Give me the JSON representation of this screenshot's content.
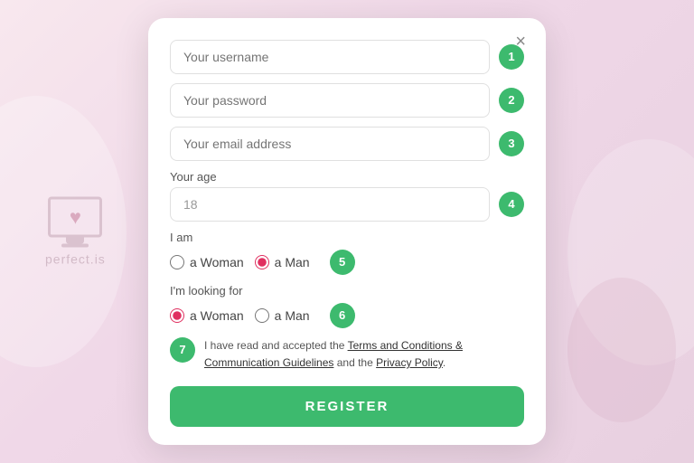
{
  "background": "#f5e0ec",
  "watermark": {
    "text": "perfect.is"
  },
  "modal": {
    "close_label": "×",
    "fields": [
      {
        "placeholder": "Your username",
        "step": "1"
      },
      {
        "placeholder": "Your password",
        "step": "2"
      },
      {
        "placeholder": "Your email address",
        "step": "3"
      }
    ],
    "age_label": "Your age",
    "age_value": "18",
    "age_step": "4",
    "i_am_label": "I am",
    "i_am_options": [
      {
        "label": "a Woman",
        "value": "woman"
      },
      {
        "label": "a Man",
        "value": "man"
      }
    ],
    "i_am_step": "5",
    "looking_for_label": "I'm looking for",
    "looking_for_options": [
      {
        "label": "a Woman",
        "value": "woman"
      },
      {
        "label": "a Man",
        "value": "man"
      }
    ],
    "looking_for_step": "6",
    "terms_step": "7",
    "terms_text": "I have read and accepted the ",
    "terms_link1": "Terms and Conditions & Communication Guidelines",
    "terms_middle": " and the ",
    "terms_link2": "Privacy Policy",
    "terms_end": ".",
    "register_label": "REGISTER"
  }
}
